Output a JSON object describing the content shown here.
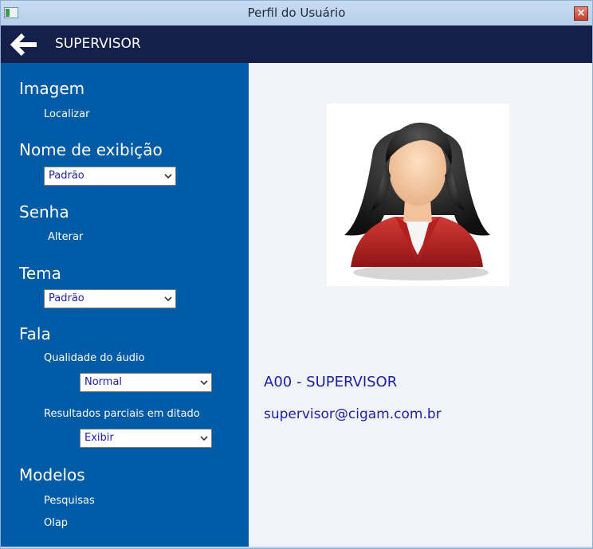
{
  "window": {
    "title": "Perfil do Usuário",
    "close_label": "×"
  },
  "header": {
    "user_name": "SUPERVISOR"
  },
  "sidebar": {
    "imagem": {
      "title": "Imagem",
      "link": "Localizar"
    },
    "nome_exibicao": {
      "title": "Nome de exibição",
      "selected": "Padrão"
    },
    "senha": {
      "title": "Senha",
      "link": "Alterar"
    },
    "tema": {
      "title": "Tema",
      "selected": "Padrão"
    },
    "fala": {
      "title": "Fala",
      "qualidade_label": "Qualidade do áudio",
      "qualidade_selected": "Normal",
      "resultados_label": "Resultados parciais em ditado",
      "resultados_selected": "Exibir"
    },
    "modelos": {
      "title": "Modelos",
      "items": [
        "Pesquisas",
        "Olap"
      ]
    }
  },
  "main": {
    "user_code": "A00 - SUPERVISOR",
    "user_email": "supervisor@cigam.com.br"
  },
  "colors": {
    "header_bg": "#14204a",
    "sidebar_bg": "#005ba6",
    "main_bg": "#f2f3f9",
    "accent_text": "#1b1fa6"
  },
  "icons": {
    "back": "arrow-left-icon",
    "dropdown": "chevron-down-icon",
    "avatar": "female-user-avatar"
  }
}
